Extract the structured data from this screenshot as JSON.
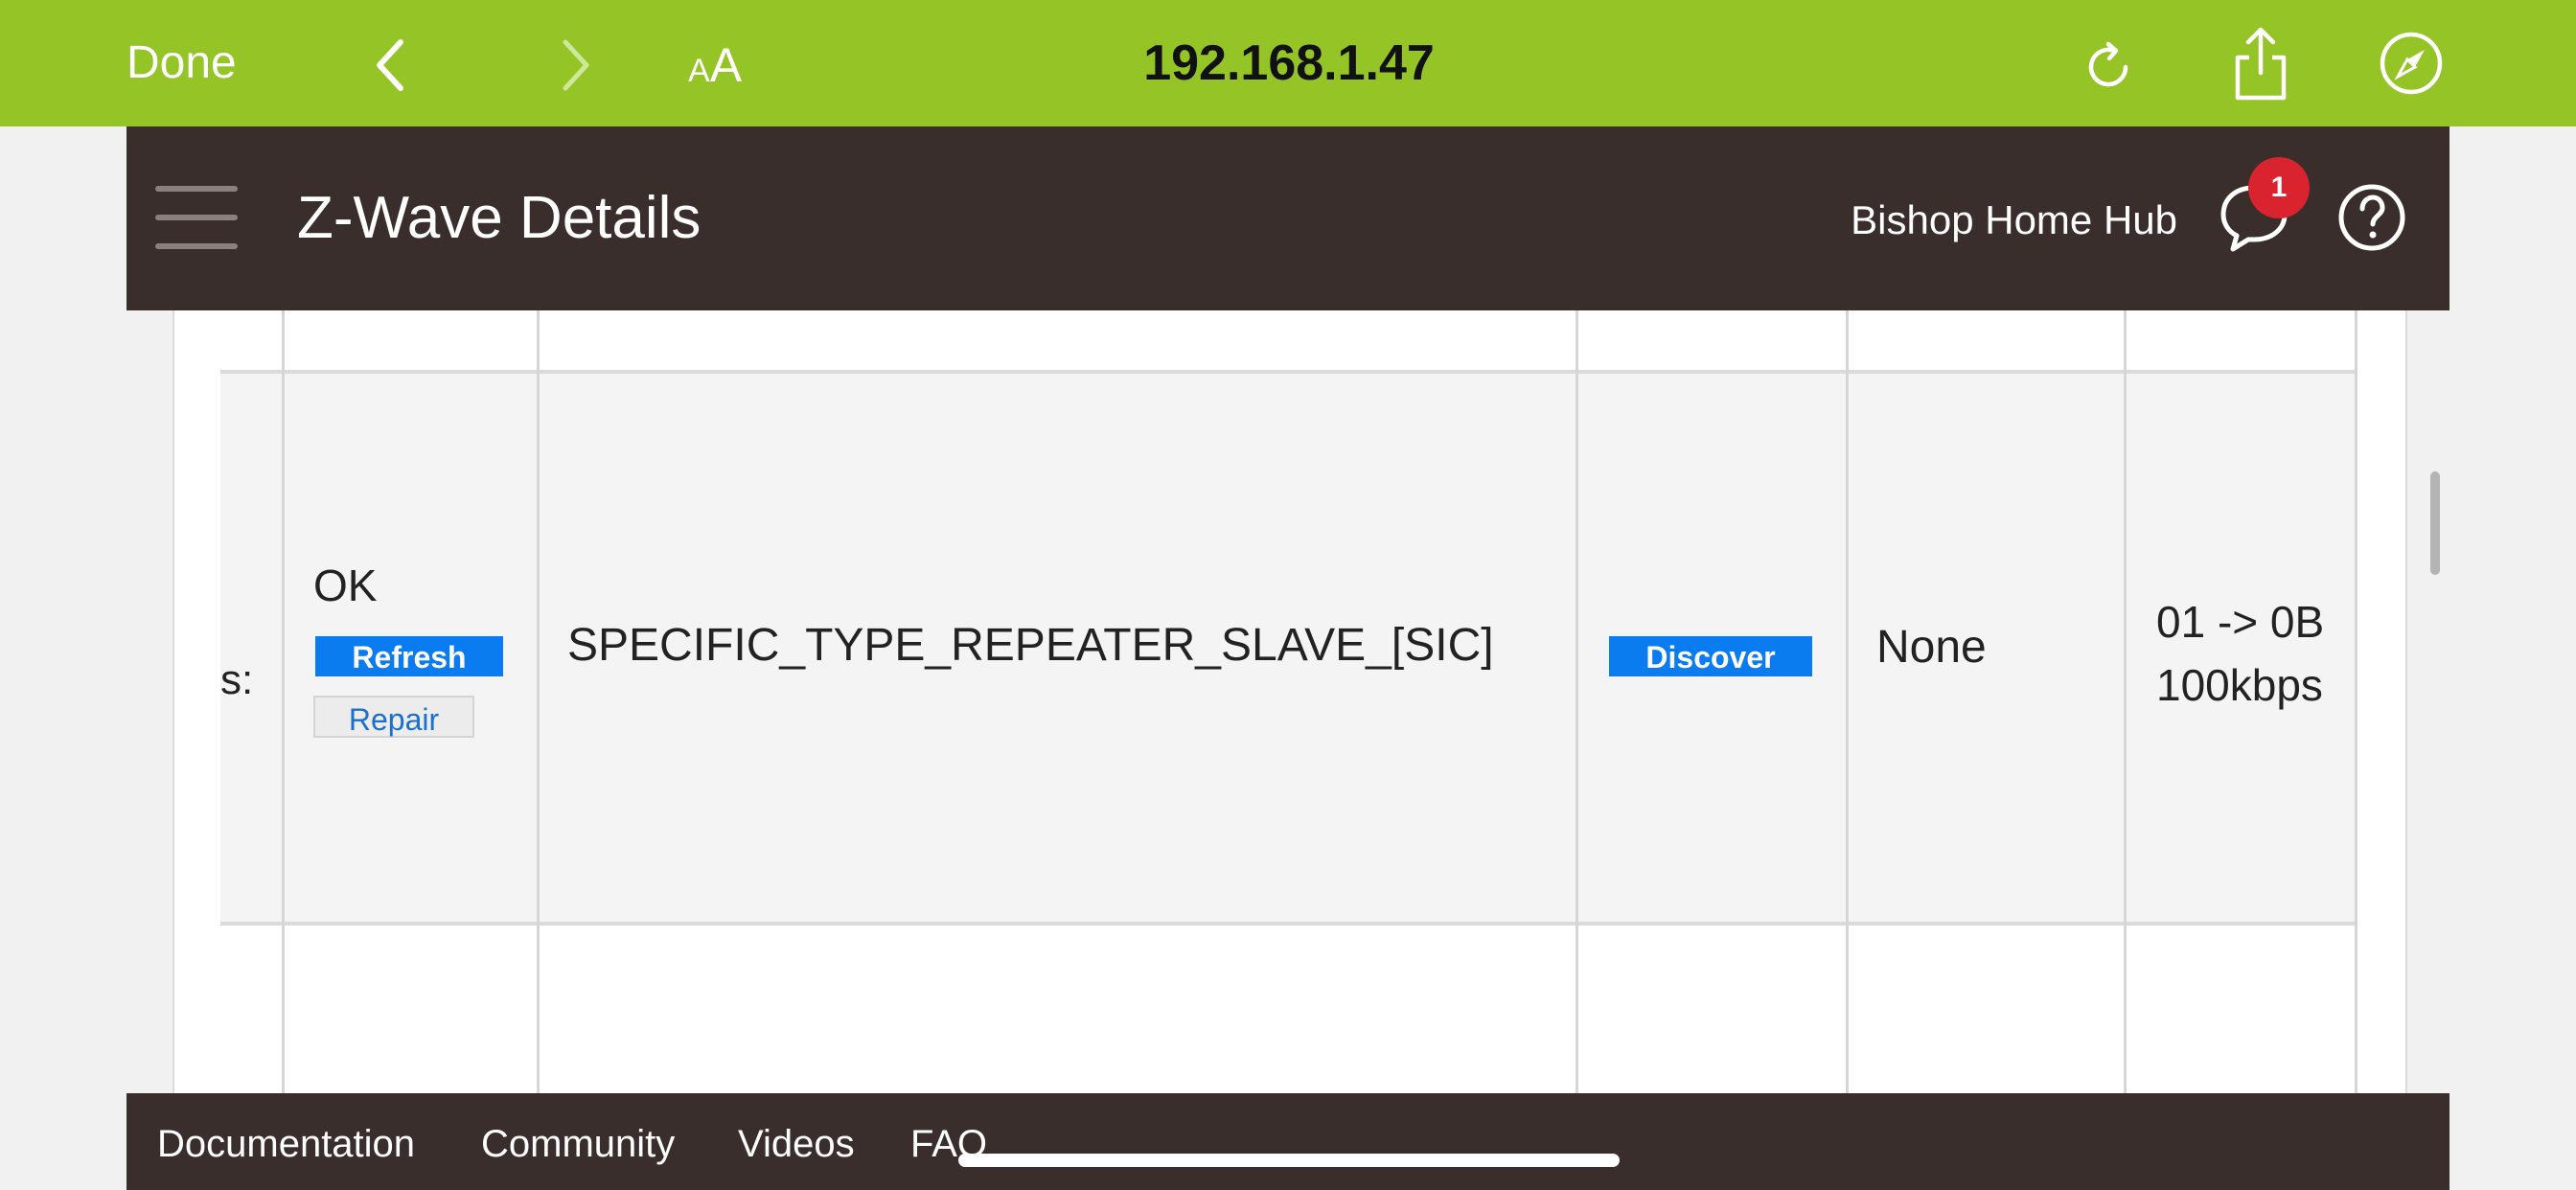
{
  "browser": {
    "done_label": "Done",
    "text_size_small": "A",
    "text_size_large": "A",
    "url": "192.168.1.47",
    "bar_color": "#94c426"
  },
  "header": {
    "title": "Z-Wave Details",
    "hub_name": "Bishop Home Hub",
    "notification_count": "1"
  },
  "table": {
    "row": {
      "status_label_cut": "s:",
      "status": "OK",
      "refresh_label": "Refresh",
      "repair_label": "Repair",
      "device_type": "SPECIFIC_TYPE_REPEATER_SLAVE_[SIC]",
      "discover_label": "Discover",
      "security": "None",
      "route": "01 -> 0B",
      "speed": "100kbps"
    }
  },
  "footer": {
    "links": [
      "Documentation",
      "Community",
      "Videos",
      "FAQ"
    ]
  },
  "colors": {
    "header_bg": "#3a2e2d",
    "button_blue": "#0b7cf0",
    "badge_red": "#d9232e"
  }
}
